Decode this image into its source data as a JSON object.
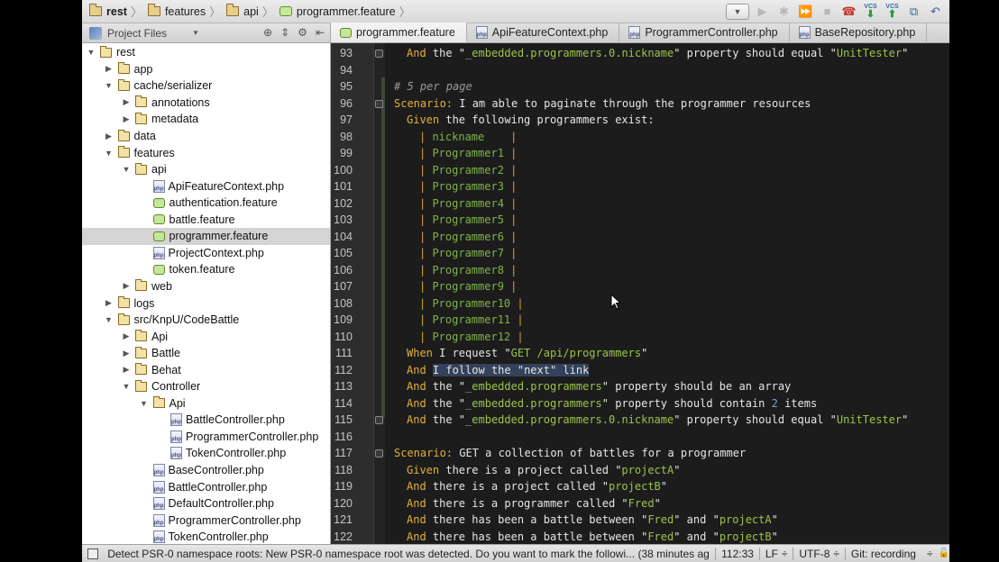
{
  "breadcrumb": [
    "rest",
    "features",
    "api",
    "programmer.feature"
  ],
  "project_panel": {
    "title": "Project Files"
  },
  "tree": [
    {
      "label": "rest",
      "depth": 0,
      "type": "folder",
      "open": true
    },
    {
      "label": "app",
      "depth": 1,
      "type": "folder",
      "open": false
    },
    {
      "label": "cache/serializer",
      "depth": 1,
      "type": "folder",
      "open": true
    },
    {
      "label": "annotations",
      "depth": 2,
      "type": "folder",
      "open": false
    },
    {
      "label": "metadata",
      "depth": 2,
      "type": "folder",
      "open": false
    },
    {
      "label": "data",
      "depth": 1,
      "type": "folder",
      "open": false
    },
    {
      "label": "features",
      "depth": 1,
      "type": "folder",
      "open": true
    },
    {
      "label": "api",
      "depth": 2,
      "type": "folder",
      "open": true
    },
    {
      "label": "ApiFeatureContext.php",
      "depth": 3,
      "type": "php"
    },
    {
      "label": "authentication.feature",
      "depth": 3,
      "type": "feature"
    },
    {
      "label": "battle.feature",
      "depth": 3,
      "type": "feature"
    },
    {
      "label": "programmer.feature",
      "depth": 3,
      "type": "feature",
      "selected": true
    },
    {
      "label": "ProjectContext.php",
      "depth": 3,
      "type": "php"
    },
    {
      "label": "token.feature",
      "depth": 3,
      "type": "feature"
    },
    {
      "label": "web",
      "depth": 2,
      "type": "folder",
      "open": false
    },
    {
      "label": "logs",
      "depth": 1,
      "type": "folder",
      "open": false
    },
    {
      "label": "src/KnpU/CodeBattle",
      "depth": 1,
      "type": "folder",
      "open": true
    },
    {
      "label": "Api",
      "depth": 2,
      "type": "folder",
      "open": false
    },
    {
      "label": "Battle",
      "depth": 2,
      "type": "folder",
      "open": false
    },
    {
      "label": "Behat",
      "depth": 2,
      "type": "folder",
      "open": false
    },
    {
      "label": "Controller",
      "depth": 2,
      "type": "folder",
      "open": true
    },
    {
      "label": "Api",
      "depth": 3,
      "type": "folder",
      "open": true
    },
    {
      "label": "BattleController.php",
      "depth": 4,
      "type": "php"
    },
    {
      "label": "ProgrammerController.php",
      "depth": 4,
      "type": "php"
    },
    {
      "label": "TokenController.php",
      "depth": 4,
      "type": "php"
    },
    {
      "label": "BaseController.php",
      "depth": 3,
      "type": "php"
    },
    {
      "label": "BattleController.php",
      "depth": 3,
      "type": "php"
    },
    {
      "label": "DefaultController.php",
      "depth": 3,
      "type": "php"
    },
    {
      "label": "ProgrammerController.php",
      "depth": 3,
      "type": "php"
    },
    {
      "label": "TokenController.php",
      "depth": 3,
      "type": "php"
    }
  ],
  "tabs": [
    {
      "label": "programmer.feature",
      "type": "feature",
      "active": true
    },
    {
      "label": "ApiFeatureContext.php",
      "type": "php"
    },
    {
      "label": "ProgrammerController.php",
      "type": "php"
    },
    {
      "label": "BaseRepository.php",
      "type": "php"
    }
  ],
  "code_lines": [
    {
      "n": "93",
      "indent": 1,
      "parts": [
        [
          "kw",
          "And"
        ],
        [
          "t",
          " the \""
        ],
        [
          "str",
          "_embedded.programmers.0.nickname"
        ],
        [
          "t",
          "\" property should equal \""
        ],
        [
          "str",
          "UnitTester"
        ],
        [
          "t",
          "\""
        ]
      ]
    },
    {
      "n": "94",
      "indent": 0,
      "parts": []
    },
    {
      "n": "95",
      "indent": 0,
      "parts": [
        [
          "cm",
          "# 5 per page"
        ]
      ]
    },
    {
      "n": "96",
      "indent": 0,
      "parts": [
        [
          "kw",
          "Scenario:"
        ],
        [
          "t",
          " I am able to paginate through the programmer resources"
        ]
      ]
    },
    {
      "n": "97",
      "indent": 1,
      "parts": [
        [
          "kw",
          "Given"
        ],
        [
          "t",
          " the following programmers exist:"
        ]
      ]
    },
    {
      "n": "98",
      "indent": 2,
      "parts": [
        [
          "pipe",
          "| "
        ],
        [
          "tbl",
          "nickname    "
        ],
        [
          "pipe",
          "|"
        ]
      ]
    },
    {
      "n": "99",
      "indent": 2,
      "parts": [
        [
          "pipe",
          "| "
        ],
        [
          "tbl",
          "Programmer1 "
        ],
        [
          "pipe",
          "|"
        ]
      ]
    },
    {
      "n": "100",
      "indent": 2,
      "parts": [
        [
          "pipe",
          "| "
        ],
        [
          "tbl",
          "Programmer2 "
        ],
        [
          "pipe",
          "|"
        ]
      ]
    },
    {
      "n": "101",
      "indent": 2,
      "parts": [
        [
          "pipe",
          "| "
        ],
        [
          "tbl",
          "Programmer3 "
        ],
        [
          "pipe",
          "|"
        ]
      ]
    },
    {
      "n": "102",
      "indent": 2,
      "parts": [
        [
          "pipe",
          "| "
        ],
        [
          "tbl",
          "Programmer4 "
        ],
        [
          "pipe",
          "|"
        ]
      ]
    },
    {
      "n": "103",
      "indent": 2,
      "parts": [
        [
          "pipe",
          "| "
        ],
        [
          "tbl",
          "Programmer5 "
        ],
        [
          "pipe",
          "|"
        ]
      ]
    },
    {
      "n": "104",
      "indent": 2,
      "parts": [
        [
          "pipe",
          "| "
        ],
        [
          "tbl",
          "Programmer6 "
        ],
        [
          "pipe",
          "|"
        ]
      ]
    },
    {
      "n": "105",
      "indent": 2,
      "parts": [
        [
          "pipe",
          "| "
        ],
        [
          "tbl",
          "Programmer7 "
        ],
        [
          "pipe",
          "|"
        ]
      ]
    },
    {
      "n": "106",
      "indent": 2,
      "parts": [
        [
          "pipe",
          "| "
        ],
        [
          "tbl",
          "Programmer8 "
        ],
        [
          "pipe",
          "|"
        ]
      ]
    },
    {
      "n": "107",
      "indent": 2,
      "parts": [
        [
          "pipe",
          "| "
        ],
        [
          "tbl",
          "Programmer9 "
        ],
        [
          "pipe",
          "|"
        ]
      ]
    },
    {
      "n": "108",
      "indent": 2,
      "parts": [
        [
          "pipe",
          "| "
        ],
        [
          "tbl",
          "Programmer10"
        ],
        [
          "pipe",
          " |"
        ]
      ]
    },
    {
      "n": "109",
      "indent": 2,
      "parts": [
        [
          "pipe",
          "| "
        ],
        [
          "tbl",
          "Programmer11"
        ],
        [
          "pipe",
          " |"
        ]
      ]
    },
    {
      "n": "110",
      "indent": 2,
      "parts": [
        [
          "pipe",
          "| "
        ],
        [
          "tbl",
          "Programmer12"
        ],
        [
          "pipe",
          " |"
        ]
      ]
    },
    {
      "n": "111",
      "indent": 1,
      "parts": [
        [
          "kw",
          "When"
        ],
        [
          "t",
          " I request \""
        ],
        [
          "str",
          "GET /api/programmers"
        ],
        [
          "t",
          "\""
        ]
      ]
    },
    {
      "n": "112",
      "indent": 1,
      "parts": [
        [
          "kw",
          "And"
        ],
        [
          "t",
          " "
        ],
        [
          "sel",
          "I follow the \"next\" link"
        ]
      ]
    },
    {
      "n": "113",
      "indent": 1,
      "parts": [
        [
          "kw",
          "And"
        ],
        [
          "t",
          " the \""
        ],
        [
          "str",
          "_embedded.programmers"
        ],
        [
          "t",
          "\" property should be an array"
        ]
      ]
    },
    {
      "n": "114",
      "indent": 1,
      "parts": [
        [
          "kw",
          "And"
        ],
        [
          "t",
          " the \""
        ],
        [
          "str",
          "_embedded.programmers"
        ],
        [
          "t",
          "\" property should contain "
        ],
        [
          "num",
          "2"
        ],
        [
          "t",
          " items"
        ]
      ]
    },
    {
      "n": "115",
      "indent": 1,
      "parts": [
        [
          "kw",
          "And"
        ],
        [
          "t",
          " the \""
        ],
        [
          "str",
          "_embedded.programmers.0.nickname"
        ],
        [
          "t",
          "\" property should equal \""
        ],
        [
          "str",
          "UnitTester"
        ],
        [
          "t",
          "\""
        ]
      ]
    },
    {
      "n": "116",
      "indent": 0,
      "parts": []
    },
    {
      "n": "117",
      "indent": 0,
      "parts": [
        [
          "kw",
          "Scenario:"
        ],
        [
          "t",
          " GET a collection of battles for a programmer"
        ]
      ]
    },
    {
      "n": "118",
      "indent": 1,
      "parts": [
        [
          "kw",
          "Given"
        ],
        [
          "t",
          " there is a project called \""
        ],
        [
          "str",
          "projectA"
        ],
        [
          "t",
          "\""
        ]
      ]
    },
    {
      "n": "119",
      "indent": 1,
      "parts": [
        [
          "kw",
          "And"
        ],
        [
          "t",
          " there is a project called \""
        ],
        [
          "str",
          "projectB"
        ],
        [
          "t",
          "\""
        ]
      ]
    },
    {
      "n": "120",
      "indent": 1,
      "parts": [
        [
          "kw",
          "And"
        ],
        [
          "t",
          " there is a programmer called \""
        ],
        [
          "str",
          "Fred"
        ],
        [
          "t",
          "\""
        ]
      ]
    },
    {
      "n": "121",
      "indent": 1,
      "parts": [
        [
          "kw",
          "And"
        ],
        [
          "t",
          " there has been a battle between \""
        ],
        [
          "str",
          "Fred"
        ],
        [
          "t",
          "\" and \""
        ],
        [
          "str",
          "projectA"
        ],
        [
          "t",
          "\""
        ]
      ]
    },
    {
      "n": "122",
      "indent": 1,
      "parts": [
        [
          "kw",
          "And"
        ],
        [
          "t",
          " there has been a battle between \""
        ],
        [
          "str",
          "Fred"
        ],
        [
          "t",
          "\" and \""
        ],
        [
          "str",
          "projectB"
        ],
        [
          "t",
          "\""
        ]
      ]
    }
  ],
  "status": {
    "message": "Detect PSR-0 namespace roots: New PSR-0 namespace root was detected. Do you want to mark the followi... (38 minutes ago)",
    "position": "112:33",
    "line_sep": "LF",
    "encoding": "UTF-8",
    "vcs": "Git: recording"
  }
}
